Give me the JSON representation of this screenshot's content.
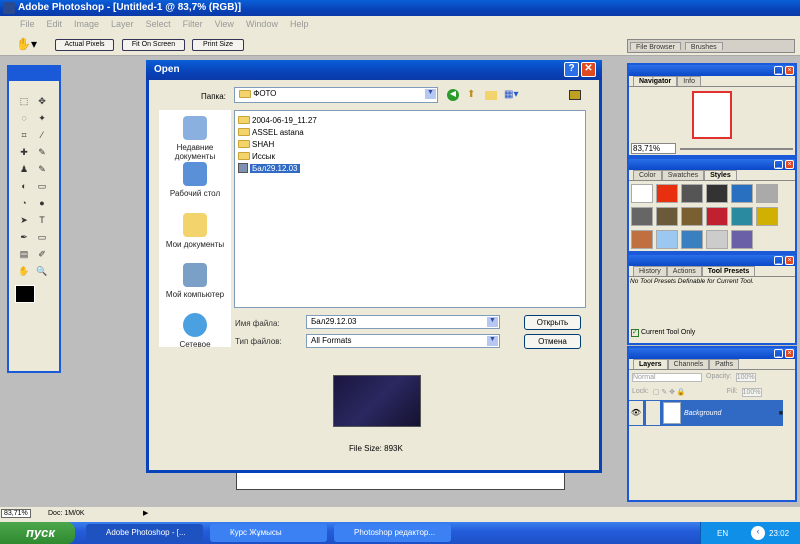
{
  "app": {
    "title": "Adobe Photoshop - [Untitled-1 @ 83,7% (RGB)]",
    "menu": [
      "File",
      "Edit",
      "Image",
      "Layer",
      "Select",
      "Filter",
      "View",
      "Window",
      "Help"
    ],
    "options": {
      "actual_pixels": "Actual Pixels",
      "fit_on_screen": "Fit On Screen",
      "print_size": "Print Size"
    },
    "palette_well": [
      "File Browser",
      "Brushes"
    ]
  },
  "dialog": {
    "title": "Open",
    "look_in_label": "Папка:",
    "look_in_value": "ФОТО",
    "places": [
      "Недавние документы",
      "Рабочий стол",
      "Мои документы",
      "Мой компьютер",
      "Сетевое"
    ],
    "files": [
      {
        "name": "2004-06-19_11.27",
        "type": "folder"
      },
      {
        "name": "ASSEL astana",
        "type": "folder"
      },
      {
        "name": "SHAH",
        "type": "folder"
      },
      {
        "name": "Иссык",
        "type": "folder"
      },
      {
        "name": "Бал29.12.03",
        "type": "file",
        "selected": true
      }
    ],
    "filename_label": "Имя файла:",
    "filename_value": "Бал29.12.03",
    "filetype_label": "Тип файлов:",
    "filetype_value": "All Formats",
    "open_button": "Открыть",
    "cancel_button": "Отмена",
    "file_size": "File Size: 893K"
  },
  "navigator": {
    "tabs": [
      "Navigator",
      "Info"
    ],
    "zoom": "83,71%"
  },
  "styles": {
    "tabs": [
      "Color",
      "Swatches",
      "Styles"
    ]
  },
  "tool_presets": {
    "tabs": [
      "History",
      "Actions",
      "Tool Presets"
    ],
    "message": "No Tool Presets Definable for Current Tool.",
    "current_tool_only": "Current Tool Only"
  },
  "layers": {
    "tabs": [
      "Layers",
      "Channels",
      "Paths"
    ],
    "blend_mode": "Normal",
    "opacity_label": "Opacity:",
    "opacity": "100%",
    "lock_label": "Lock:",
    "fill_label": "Fill:",
    "fill": "100%",
    "layer_name": "Background"
  },
  "status": {
    "zoom": "83,71%",
    "doc": "Doc: 1M/0K"
  },
  "taskbar": {
    "start": "пуск",
    "items": [
      "Adobe Photoshop - [...",
      "Курс Жұмысы",
      "Photoshop редактор..."
    ],
    "lang": "EN",
    "time": "23:02"
  }
}
